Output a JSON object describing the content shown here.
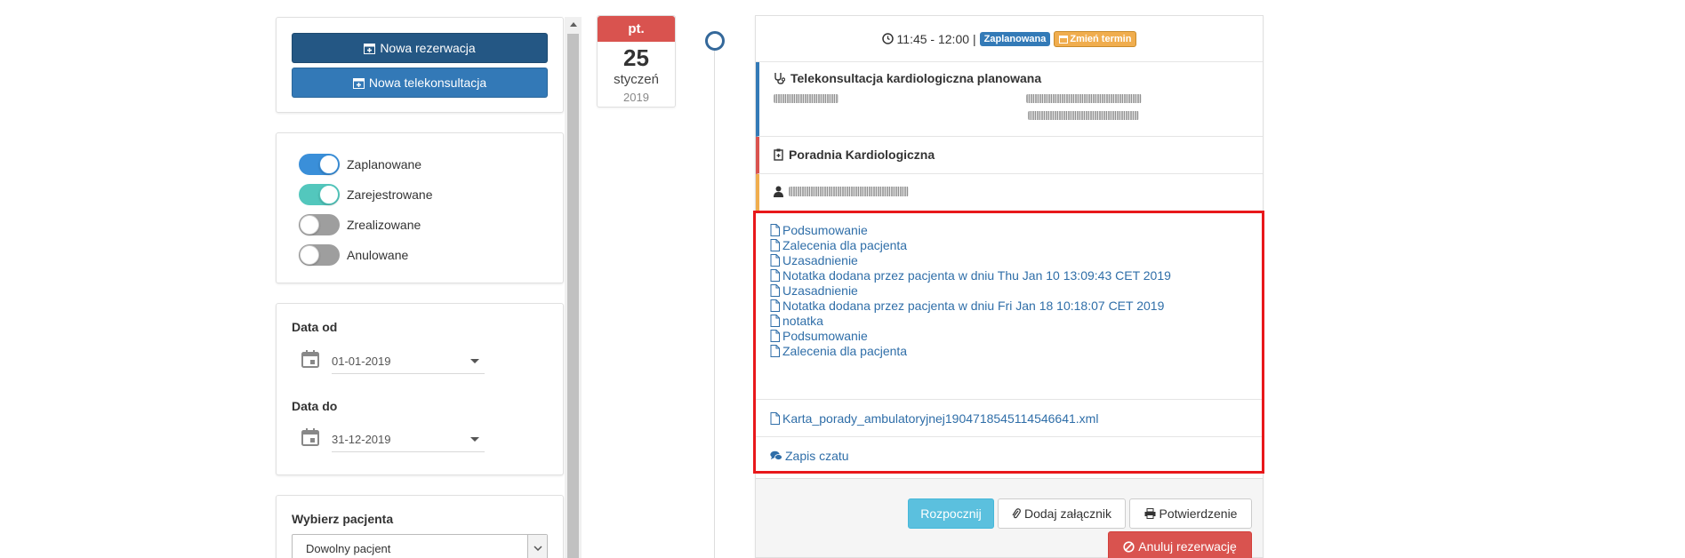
{
  "actions": {
    "new_reservation": "Nowa rezerwacja",
    "new_teleconsultation": "Nowa telekonsultacja"
  },
  "filters": [
    {
      "label": "Zaplanowane",
      "on": true,
      "color": "#3a8fd9"
    },
    {
      "label": "Zarejestrowane",
      "on": true,
      "color": "#53c7bd"
    },
    {
      "label": "Zrealizowane",
      "on": false,
      "color": "#9e9e9e"
    },
    {
      "label": "Anulowane",
      "on": false,
      "color": "#9e9e9e"
    }
  ],
  "dates": {
    "from_label": "Data od",
    "from_value": "01-01-2019",
    "to_label": "Data do",
    "to_value": "31-12-2019"
  },
  "patient": {
    "label": "Wybierz pacjenta",
    "selected": "Dowolny pacjent"
  },
  "date_badge": {
    "dow": "pt.",
    "day": "25",
    "month": "styczeń",
    "year": "2019"
  },
  "visit": {
    "time": "11:45 - 12:00",
    "separator": "|",
    "status_badge": "Zaplanowana",
    "reschedule_badge": "Zmień termin",
    "type": "Telekonsultacja kardiologiczna planowana",
    "clinic": "Poradnia Kardiologiczna"
  },
  "documents": [
    "Podsumowanie",
    "Zalecenia dla pacjenta",
    "Uzasadnienie",
    "Notatka dodana przez pacjenta w dniu Thu Jan 10 13:09:43 CET 2019",
    "Uzasadnienie",
    "Notatka dodana przez pacjenta w dniu Fri Jan 18 10:18:07 CET 2019",
    "notatka",
    "Podsumowanie",
    "Zalecenia dla pacjenta"
  ],
  "xml_file": "Karta_porady_ambulatoryjnej1904718545114546641.xml",
  "chat_log": "Zapis czatu",
  "footer": {
    "start": "Rozpocznij",
    "attach": "Dodaj załącznik",
    "confirm": "Potwierdzenie",
    "cancel": "Anuluj rezerwację"
  },
  "colors": {
    "primary_dark": "#245784",
    "primary": "#3379b7",
    "danger": "#d9534f",
    "warning": "#f0ad4e",
    "info": "#5bc0de",
    "link": "#2f6ea8",
    "highlight": "#e8181b"
  }
}
